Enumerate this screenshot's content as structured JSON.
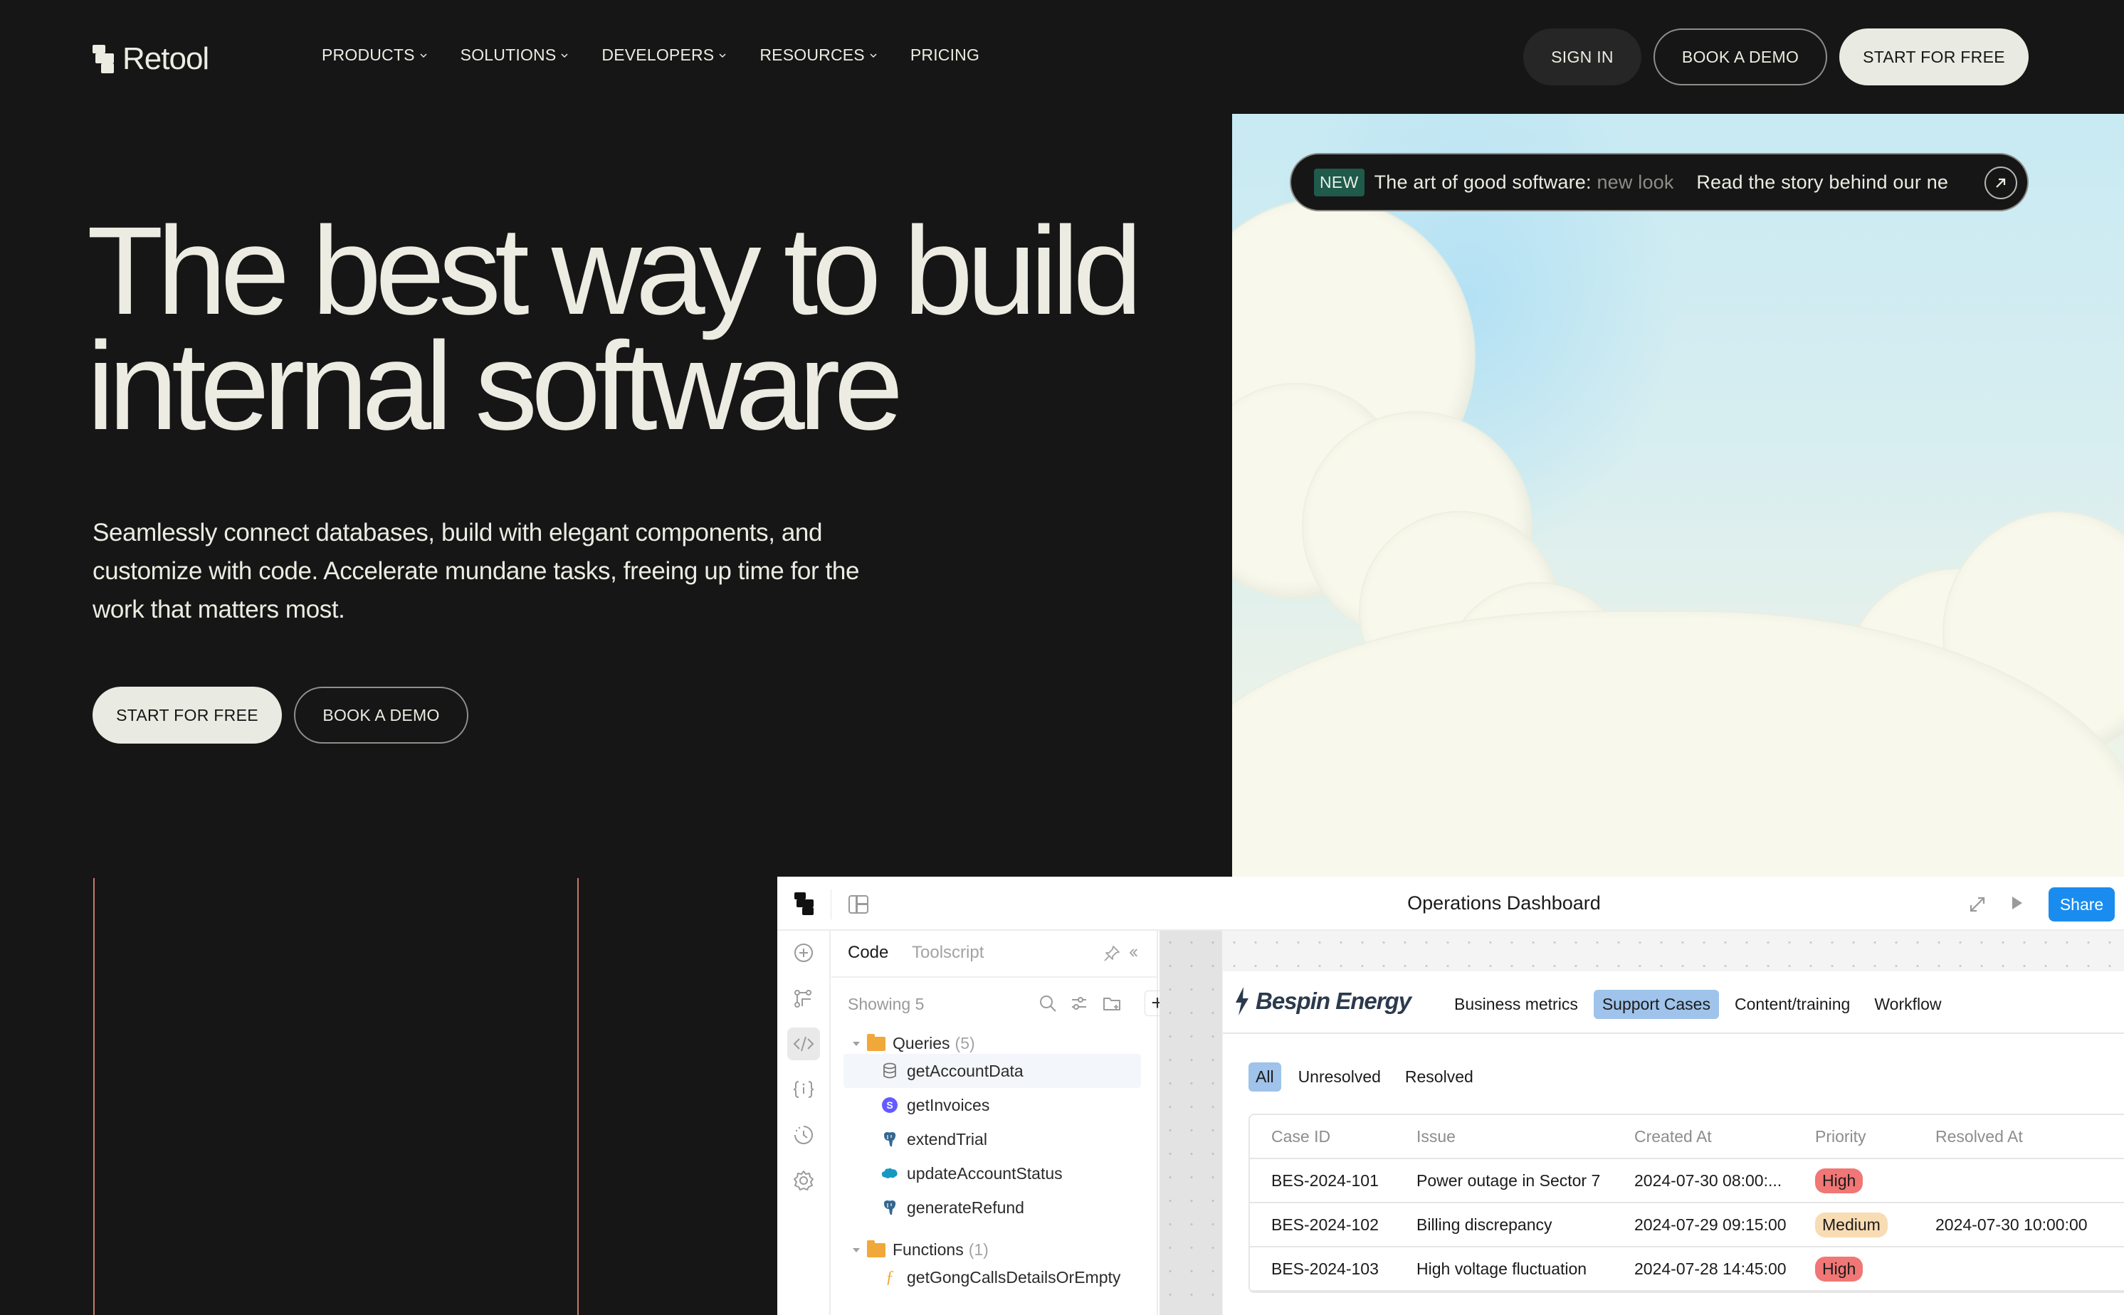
{
  "nav": {
    "logo_text": "Retool",
    "links": [
      {
        "label": "PRODUCTS",
        "has_dropdown": true
      },
      {
        "label": "SOLUTIONS",
        "has_dropdown": true
      },
      {
        "label": "DEVELOPERS",
        "has_dropdown": true
      },
      {
        "label": "RESOURCES",
        "has_dropdown": true
      },
      {
        "label": "PRICING",
        "has_dropdown": false
      }
    ],
    "sign_in": "SIGN IN",
    "book_demo": "BOOK A DEMO",
    "start_free": "START FOR FREE"
  },
  "hero": {
    "headline_line1": "The best way to build",
    "headline_line2": "internal software",
    "subtext": "Seamlessly connect databases, build with elegant components, and customize with code. Accelerate mundane tasks, freeing up time for the work that matters most.",
    "cta_primary": "START FOR FREE",
    "cta_secondary": "BOOK A DEMO"
  },
  "announcement": {
    "badge": "NEW",
    "text_main": "The art of good software:",
    "text_faded": "new look",
    "text_secondary": "Read the story behind our ne",
    "icon": "arrow-up-right-icon"
  },
  "app": {
    "title": "Operations Dashboard",
    "share_label": "Share",
    "header_icons": [
      "retool-logo-icon",
      "layout-icon",
      "expand-icon",
      "play-icon"
    ],
    "rail_icons": [
      "add-icon",
      "flow-icon",
      "code-icon",
      "state-icon",
      "history-icon",
      "settings-icon"
    ],
    "active_rail": "code-icon",
    "code_panel": {
      "tab_active": "Code",
      "tab_inactive": "Toolscript",
      "showing": "Showing 5",
      "add_label": "+",
      "folders": [
        {
          "name": "Queries",
          "count": "(5)",
          "items": [
            {
              "name": "getAccountData",
              "icon": "database-icon",
              "selected": true
            },
            {
              "name": "getInvoices",
              "icon": "stripe-icon",
              "selected": false
            },
            {
              "name": "extendTrial",
              "icon": "postgres-icon",
              "selected": false
            },
            {
              "name": "updateAccountStatus",
              "icon": "salesforce-icon",
              "selected": false
            },
            {
              "name": "generateRefund",
              "icon": "postgres-icon",
              "selected": false
            }
          ]
        },
        {
          "name": "Functions",
          "count": "(1)",
          "items": [
            {
              "name": "getGongCallsDetailsOrEmpty",
              "icon": "function-icon",
              "selected": false
            }
          ]
        }
      ]
    },
    "dashboard": {
      "brand": "Bespin Energy",
      "tabs": [
        "Business metrics",
        "Support Cases",
        "Content/training",
        "Workflow"
      ],
      "active_tab": "Support Cases",
      "filters": [
        "All",
        "Unresolved",
        "Resolved"
      ],
      "active_filter": "All",
      "table": {
        "columns": [
          "Case ID",
          "Issue",
          "Created At",
          "Priority",
          "Resolved At"
        ],
        "rows": [
          {
            "case_id": "BES-2024-101",
            "issue": "Power outage in Sector 7",
            "created_at": "2024-07-30 08:00:...",
            "priority": "High",
            "resolved_at": ""
          },
          {
            "case_id": "BES-2024-102",
            "issue": "Billing discrepancy",
            "created_at": "2024-07-29 09:15:00",
            "priority": "Medium",
            "resolved_at": "2024-07-30 10:00:00"
          },
          {
            "case_id": "BES-2024-103",
            "issue": "High voltage fluctuation",
            "created_at": "2024-07-28 14:45:00",
            "priority": "High",
            "resolved_at": ""
          }
        ]
      }
    }
  },
  "colors": {
    "background": "#161616",
    "text_light": "#ecece3",
    "accent_button": "#e9eae1",
    "grid_lines": "#c97a6a",
    "new_badge": "#1f5a4a",
    "share_blue": "#1a8cf0",
    "tab_active": "#9fc3ea",
    "priority_high": "#f17676",
    "priority_medium": "#f8dcb4"
  }
}
